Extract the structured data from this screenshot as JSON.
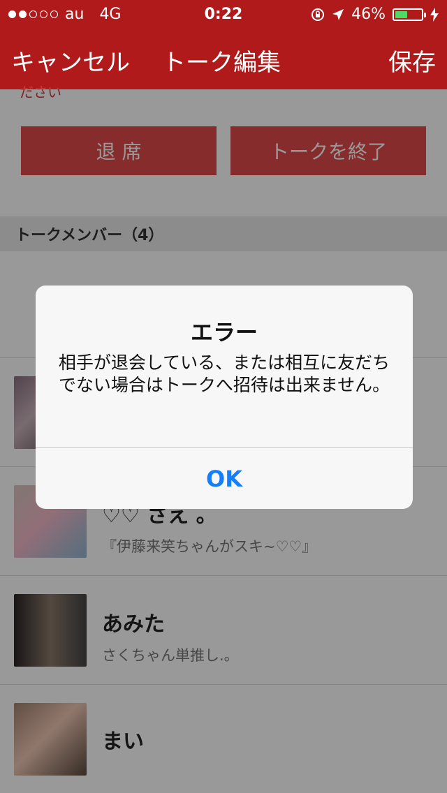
{
  "status_bar": {
    "carrier": "au",
    "network": "4G",
    "time": "0:22",
    "battery_percent": "46%",
    "battery_level": 0.46,
    "icons": [
      "lock-rotation-icon",
      "location-arrow-icon",
      "charging-bolt-icon"
    ]
  },
  "nav": {
    "cancel_label": "キャンセル",
    "title": "トーク編集",
    "save_label": "保存"
  },
  "content": {
    "partial_text": "ださい",
    "leave_button": "退 席",
    "end_talk_button": "トークを終了",
    "section_header": "トークメンバー（4）",
    "members": [
      {
        "name": "♡♡ さえ 。",
        "status": "『伊藤来笑ちゃんがスキ~♡♡』"
      },
      {
        "name": "あみた",
        "status": "さくちゃん単推し.。"
      },
      {
        "name": "まい",
        "status": ""
      }
    ]
  },
  "alert": {
    "title": "エラー",
    "message": "相手が退会している、または相互に友だちでない場合はトークへ招待は出来ません。",
    "ok_label": "OK"
  },
  "colors": {
    "header": "#b01a1a",
    "button": "#e24a4a",
    "accent_blue": "#147efb"
  }
}
